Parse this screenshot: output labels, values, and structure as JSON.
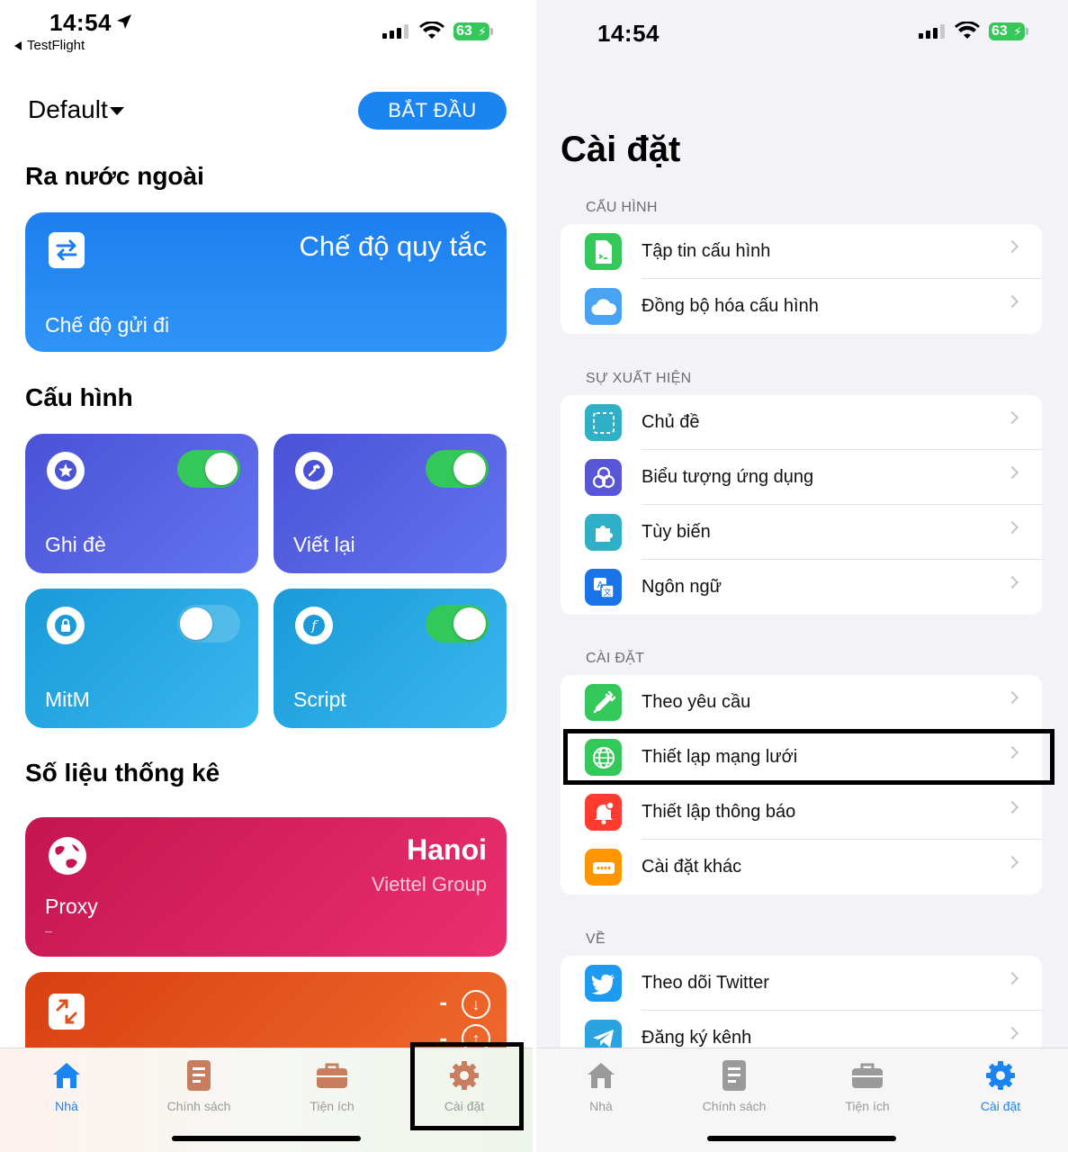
{
  "left": {
    "status": {
      "time": "14:54",
      "back_label": "TestFlight",
      "battery": "63"
    },
    "profile_selector": "Default",
    "start_button": "BẮT ĐẦU",
    "sections": {
      "abroad": "Ra nước ngoài",
      "config": "Cấu hình",
      "stats": "Số liệu thống kê"
    },
    "rule_card": {
      "title": "Chế độ quy tắc",
      "subtitle": "Chế độ gửi đi"
    },
    "feature_cards": [
      {
        "label": "Ghi đè",
        "enabled": true,
        "icon": "star-icon"
      },
      {
        "label": "Viết lại",
        "enabled": true,
        "icon": "hammer-icon"
      },
      {
        "label": "MitM",
        "enabled": false,
        "icon": "lock-icon"
      },
      {
        "label": "Script",
        "enabled": true,
        "icon": "function-icon"
      }
    ],
    "proxy_card": {
      "city": "Hanoi",
      "isp": "Viettel Group",
      "label": "Proxy",
      "dash": "–"
    },
    "traffic_card": {
      "down": "-",
      "up": "-"
    }
  },
  "right": {
    "status": {
      "time": "14:54",
      "battery": "63"
    },
    "title": "Cài đặt",
    "groups": [
      {
        "header": "CẤU HÌNH",
        "items": [
          "Tập tin cấu hình",
          "Đồng bộ hóa cấu hình"
        ]
      },
      {
        "header": "SỰ XUẤT HIỆN",
        "items": [
          "Chủ đề",
          "Biểu tượng ứng dụng",
          "Tùy biến",
          "Ngôn ngữ"
        ]
      },
      {
        "header": "CÀI ĐẶT",
        "items": [
          "Theo yêu cầu",
          "Thiết lạp mạng lưới",
          "Thiết lập thông báo",
          "Cài đặt khác"
        ]
      },
      {
        "header": "VỀ",
        "items": [
          "Theo dõi Twitter",
          "Đăng ký kênh"
        ]
      }
    ]
  },
  "tabbar": {
    "tabs": [
      "Nhà",
      "Chính sách",
      "Tiện ích",
      "Cài đặt"
    ],
    "left_active": "Nhà",
    "right_active": "Cài đặt"
  },
  "colors": {
    "accent": "#1a84f0",
    "toggle_on": "#34c759"
  }
}
